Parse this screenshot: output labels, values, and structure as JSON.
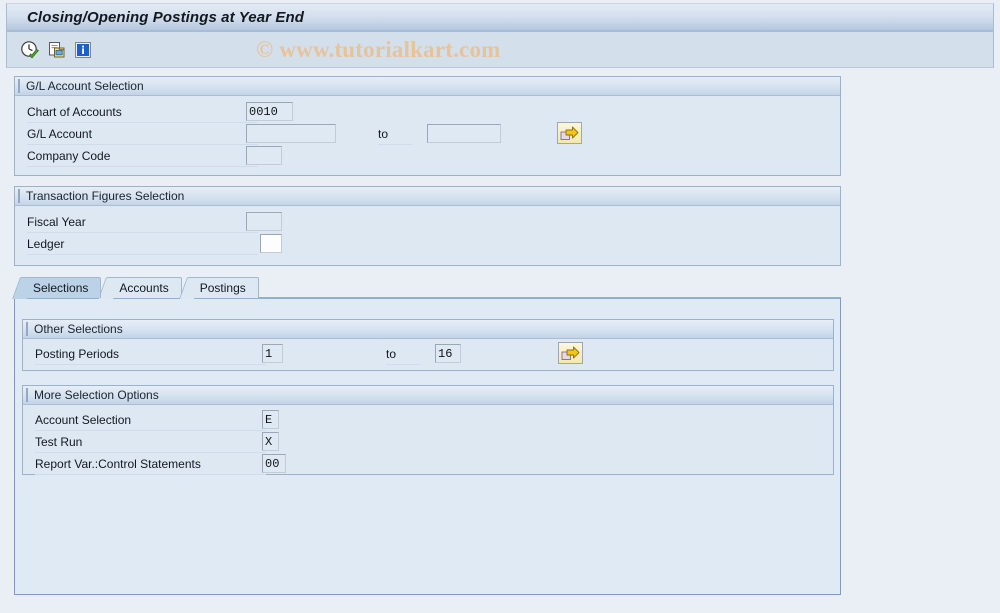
{
  "window": {
    "title": "Closing/Opening Postings at Year End"
  },
  "watermark": {
    "text": "© www.tutorialkart.com",
    "color": "#e8c39a"
  },
  "toolbar": {
    "buttons": [
      {
        "name": "execute-icon",
        "tooltip": "Execute"
      },
      {
        "name": "execute-background-icon",
        "tooltip": "Execute in Background"
      },
      {
        "name": "info-icon",
        "tooltip": "Information"
      }
    ]
  },
  "gl_account_selection": {
    "title": "G/L Account Selection",
    "fields": [
      {
        "label": "Chart of Accounts",
        "value": "0010"
      },
      {
        "label": "G/L Account",
        "value": "",
        "to_label": "to",
        "to_value": ""
      },
      {
        "label": "Company Code",
        "value": ""
      }
    ],
    "multi_select_button": "multiple-selection"
  },
  "transaction_figures_selection": {
    "title": "Transaction Figures Selection",
    "fields": [
      {
        "label": "Fiscal Year",
        "value": ""
      },
      {
        "label": "Ledger",
        "value": ""
      }
    ]
  },
  "tabs": [
    {
      "label": "Selections",
      "active": true
    },
    {
      "label": "Accounts",
      "active": false
    },
    {
      "label": "Postings",
      "active": false
    }
  ],
  "other_selections": {
    "title": "Other Selections",
    "fields": [
      {
        "label": "Posting Periods",
        "value": "1",
        "to_label": "to",
        "to_value": "16"
      }
    ],
    "multi_select_button": "multiple-selection"
  },
  "more_selection_options": {
    "title": "More Selection Options",
    "fields": [
      {
        "label": "Account Selection",
        "value": "E"
      },
      {
        "label": "Test Run",
        "value": "X"
      },
      {
        "label": "Report Var.:Control Statements",
        "value": "00"
      }
    ]
  },
  "colors": {
    "window_background": "#eaeff6",
    "panel_background": "#dde8f3",
    "panel_border": "#9ab2cd",
    "title_accent": "#b6c9df",
    "active_tab": "#bcd2e7",
    "inactive_tab": "#dde8f2",
    "field_background": "#dfe9f3",
    "button_yellow": "#f6e6b0"
  }
}
